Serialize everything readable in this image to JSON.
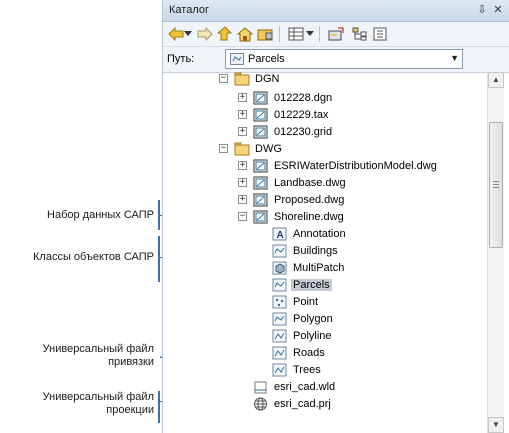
{
  "window": {
    "title": "Каталог",
    "pin_glyph": "⇩",
    "close_glyph": "✕"
  },
  "path": {
    "label": "Путь:",
    "value": "Parcels"
  },
  "tree": [
    {
      "label": "DGN",
      "icon": "folder-icon",
      "expander": "⊟"
    },
    {
      "label": "012228.dgn",
      "icon": "cad-dataset-icon",
      "expander": "⊞"
    },
    {
      "label": "012229.tax",
      "icon": "cad-dataset-icon",
      "expander": "⊞"
    },
    {
      "label": "012230.grid",
      "icon": "cad-dataset-icon",
      "expander": "⊞"
    },
    {
      "label": "DWG",
      "icon": "folder-icon",
      "expander": "⊟"
    },
    {
      "label": "ESRIWaterDistributionModel.dwg",
      "icon": "cad-dataset-icon",
      "expander": "⊞"
    },
    {
      "label": "Landbase.dwg",
      "icon": "cad-dataset-icon",
      "expander": "⊞"
    },
    {
      "label": "Proposed.dwg",
      "icon": "cad-dataset-icon",
      "expander": "⊞"
    },
    {
      "label": "Shoreline.dwg",
      "icon": "cad-dataset-icon",
      "expander": "⊟"
    },
    {
      "label": "Annotation",
      "icon": "annotation-class-icon"
    },
    {
      "label": "Buildings",
      "icon": "polygon-class-icon"
    },
    {
      "label": "MultiPatch",
      "icon": "multipatch-class-icon"
    },
    {
      "label": "Parcels",
      "icon": "polygon-class-icon",
      "selected": true
    },
    {
      "label": "Point",
      "icon": "point-class-icon"
    },
    {
      "label": "Polygon",
      "icon": "polygon-class-icon"
    },
    {
      "label": "Polyline",
      "icon": "polyline-class-icon"
    },
    {
      "label": "Roads",
      "icon": "polyline-class-icon"
    },
    {
      "label": "Trees",
      "icon": "polyline-class-icon"
    },
    {
      "label": "esri_cad.wld",
      "icon": "world-file-icon"
    },
    {
      "label": "esri_cad.prj",
      "icon": "projection-file-icon"
    }
  ],
  "annotations": {
    "cad_dataset": "Набор данных САПР",
    "feature_classes": "Классы объектов САПР",
    "world_file_1": "Универсальный файл",
    "world_file_2": "привязки",
    "proj_file_1": "Универсальный файл",
    "proj_file_2": "проекции"
  },
  "colors": {
    "annotation_line": "#3e6fb5",
    "selection": "#c5cbd6"
  }
}
